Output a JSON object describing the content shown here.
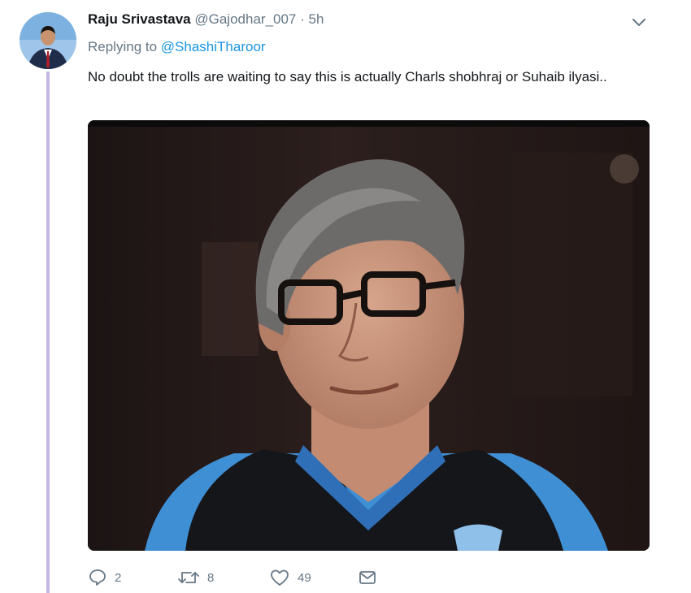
{
  "tweet": {
    "author_name": "Raju Srivastava",
    "author_handle": "@Gajodhar_007",
    "separator": "·",
    "time": "5h",
    "reply_prefix": "Replying to",
    "reply_mention": "@ShashiTharoor",
    "text": "No doubt the trolls are waiting to say this is actually Charls shobhraj or Suhaib ilyasi..",
    "image_alt": "Photo of a man with grey hair and glasses wearing a black vest over a blue shirt"
  },
  "actions": {
    "reply_count": "2",
    "retweet_count": "8",
    "like_count": "49"
  },
  "icons": {
    "more": "chevron-down-icon",
    "reply": "reply-icon",
    "retweet": "retweet-icon",
    "like": "heart-icon",
    "dm": "envelope-icon"
  },
  "colors": {
    "link": "#1b95e0",
    "muted": "#657786",
    "thread_line": "#c4b8e2"
  }
}
